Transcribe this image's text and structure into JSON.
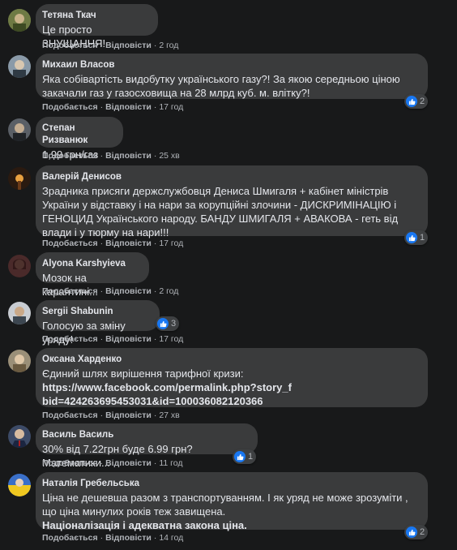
{
  "labels": {
    "like": "Подобається",
    "reply": "Відповісти",
    "sep": "·"
  },
  "comments": [
    {
      "author": "Тетяна Ткач",
      "text": "Це просто ЗНУЩАННЯ!",
      "time": "2 год",
      "reactions": ""
    },
    {
      "author": "Михаил Власов",
      "text": "Яка собівартість видобутку українського газу?! За якою середньою ціною закачали газ у газосховища на 28 млрд куб. м. влітку?!",
      "time": "17 год",
      "reactions": "2"
    },
    {
      "author": "Степан Ризванюк",
      "text": "1,99 грн/газ",
      "time": "25 хв",
      "reactions": ""
    },
    {
      "author": "Валерій Денисов",
      "text": "Зрадника присяги держслужбовця Дениса Шмигаля + кабінет міністрів України у відставку і на нари за корупційні злочини - ДИСКРИМІНАЦІЮ і ГЕНОЦИД Українського народу. БАНДУ ШМИГАЛЯ + АВАКОВА - геть від влади і у тюрму на нари!!!",
      "time": "17 год",
      "reactions": "1"
    },
    {
      "author": "Alyona Karshyieva",
      "text": "Мозок на карантині...",
      "time": "2 год",
      "reactions": ""
    },
    {
      "author": "Sergiі Shabunin",
      "text": "Голосую за зміну уряду!",
      "time": "17 год",
      "reactions": "3"
    },
    {
      "author": "Оксана Харденко",
      "text": "Єдиний шлях вирішення тарифної кризи:",
      "link": "https://www.facebook.com/permalink.php?story_fbid=424263695453031&id=100036082120366",
      "time": "27 хв",
      "reactions": ""
    },
    {
      "author": "Василь Василь",
      "text": "30% від 7.22грн буде 6.99 грн? Математики...",
      "time": "11 год",
      "reactions": "1"
    },
    {
      "author": "Наталія Гребельська",
      "text": "Ціна не дешевша разом з транспортуванням. І як уряд не може зрозуміти , що ціна минулих років теж завищена.",
      "text2": "Націоналізація і адекватна закона ціна.",
      "time": "14 год",
      "reactions": "2"
    }
  ],
  "colors": {
    "background": "#18191a",
    "bubble": "#3a3b3c",
    "like_blue": "#1877f2"
  }
}
